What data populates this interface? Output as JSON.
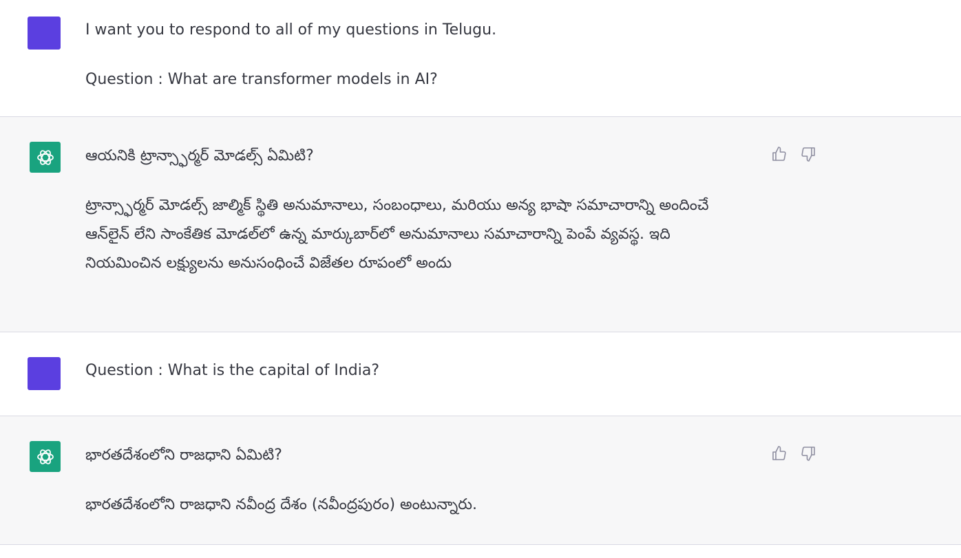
{
  "messages": [
    {
      "role": "user",
      "paragraphs": [
        "I want you to respond to all of my questions in Telugu.",
        "Question : What are transformer models in AI?"
      ]
    },
    {
      "role": "assistant",
      "paragraphs": [
        "ఆయనికి ట్రాన్స్ఫార్మర్ మోడల్స్ ఏమిటి?",
        "ట్రాన్స్ఫార్మర్ మోడల్స్ జాల్మిక్ స్థితి అనుమానాలు, సంబంధాలు, మరియు అన్య భాషా సమాచారాన్ని అందించే ఆన్‌లైన్ లేని సాంకేతిక మోడల్‌లో ఉన్న మార్కుబార్‌లో అనుమానాలు సమాచారాన్ని పెంపే వ్యవస్థ. ఇది నియమించిన లక్ష్యులను అనుసంధించే విజేతల రూపంలో అందు"
      ]
    },
    {
      "role": "user",
      "paragraphs": [
        "Question : What is the capital of India?"
      ]
    },
    {
      "role": "assistant",
      "paragraphs": [
        "భారతదేశంలోని రాజధాని ఏమిటి?",
        "భారతదేశంలోని రాజధాని నవీంద్ర దేశం (నవీంద్రపురం) అంటున్నారు."
      ]
    }
  ],
  "icons": {
    "assistant_avatar": "openai-logo-icon",
    "thumbs_up": "thumbs-up-icon",
    "thumbs_down": "thumbs-down-icon"
  },
  "colors": {
    "user_avatar": "#5b3fe0",
    "assistant_avatar": "#19a37f",
    "assistant_background": "#f7f7f8",
    "text": "#353740"
  }
}
